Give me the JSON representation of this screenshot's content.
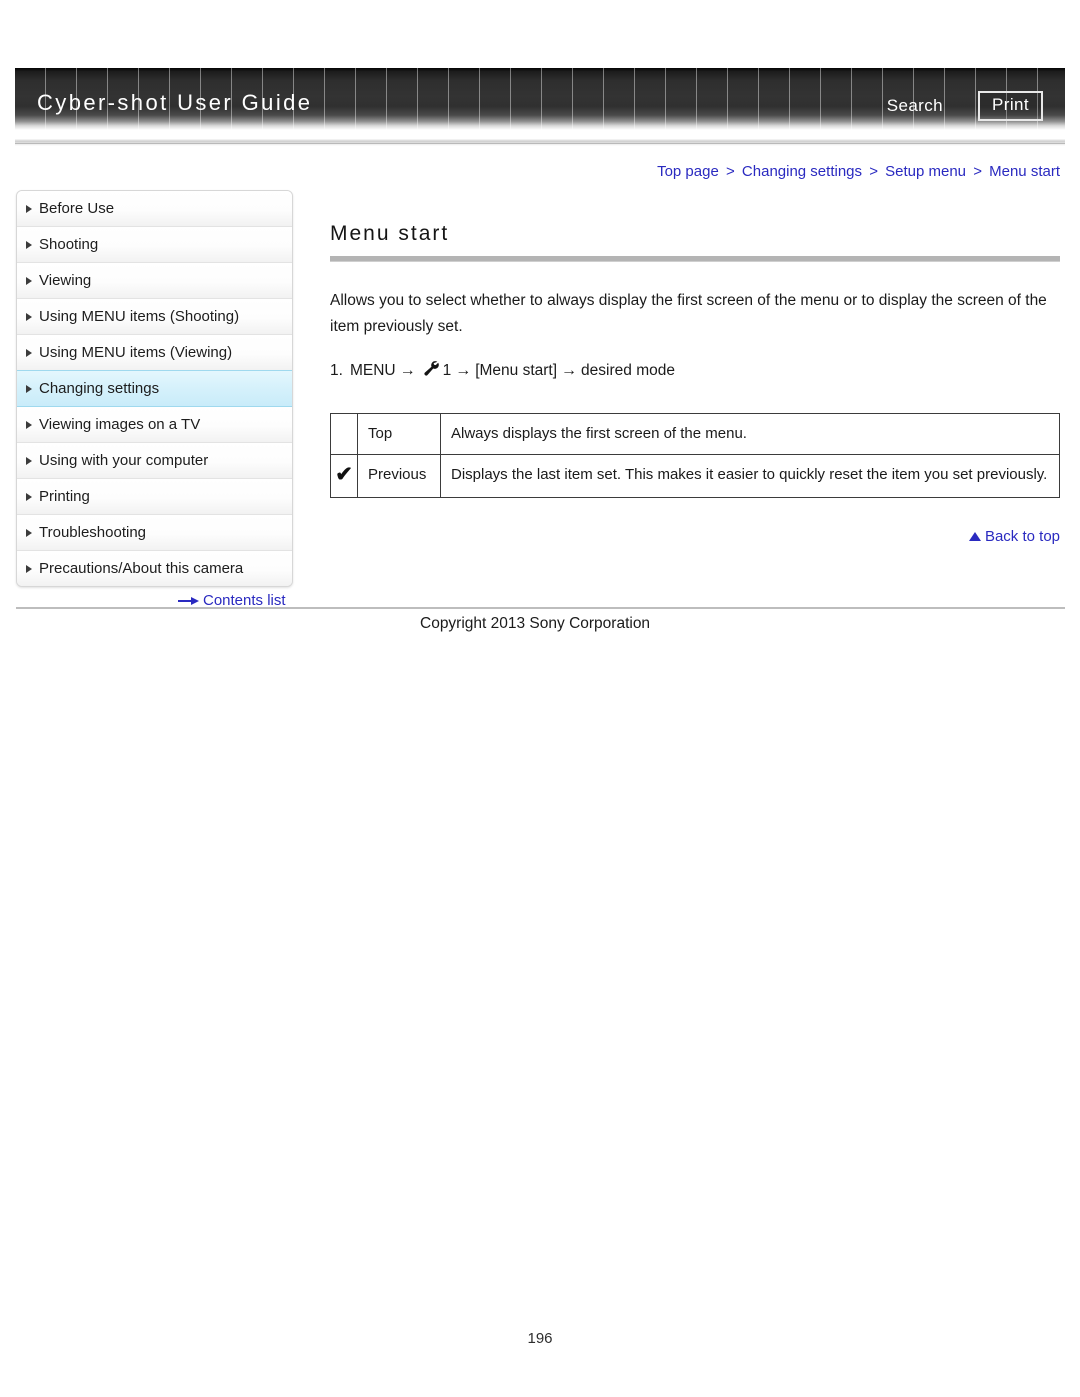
{
  "header": {
    "brand_title": "Cyber-shot User Guide",
    "search_label": "Search",
    "print_label": "Print"
  },
  "breadcrumb": {
    "items": [
      "Top page",
      "Changing settings",
      "Setup menu",
      "Menu start"
    ],
    "separator": ">"
  },
  "sidebar": {
    "items": [
      {
        "label": "Before Use",
        "active": false
      },
      {
        "label": "Shooting",
        "active": false
      },
      {
        "label": "Viewing",
        "active": false
      },
      {
        "label": "Using MENU items (Shooting)",
        "active": false
      },
      {
        "label": "Using MENU items (Viewing)",
        "active": false
      },
      {
        "label": "Changing settings",
        "active": true
      },
      {
        "label": "Viewing images on a TV",
        "active": false
      },
      {
        "label": "Using with your computer",
        "active": false
      },
      {
        "label": "Printing",
        "active": false
      },
      {
        "label": "Troubleshooting",
        "active": false
      },
      {
        "label": "Precautions/About this camera",
        "active": false
      }
    ],
    "contents_list_label": "Contents list"
  },
  "main": {
    "title": "Menu start",
    "intro": "Allows you to select whether to always display the first screen of the menu or to display the screen of the item previously set.",
    "step": {
      "number": "1.",
      "menu_label": "MENU",
      "arrow": "→",
      "setup_icon": "wrench-icon",
      "setup_number": "1",
      "bracket_item": "[Menu start]",
      "result": "desired mode"
    },
    "options_table": {
      "rows": [
        {
          "selected": "",
          "label": "Top",
          "description": "Always displays the first screen of the menu."
        },
        {
          "selected": "✔",
          "label": "Previous",
          "description": "Displays the last item set. This makes it easier to quickly reset the item you set previously."
        }
      ]
    },
    "back_to_top_label": "Back to top"
  },
  "footer": {
    "copyright": "Copyright 2013 Sony Corporation",
    "page_number": "196"
  },
  "colors": {
    "link_blue": "#2a2ac0",
    "active_nav": "#d5f1fb",
    "header_dark": "#333333"
  }
}
